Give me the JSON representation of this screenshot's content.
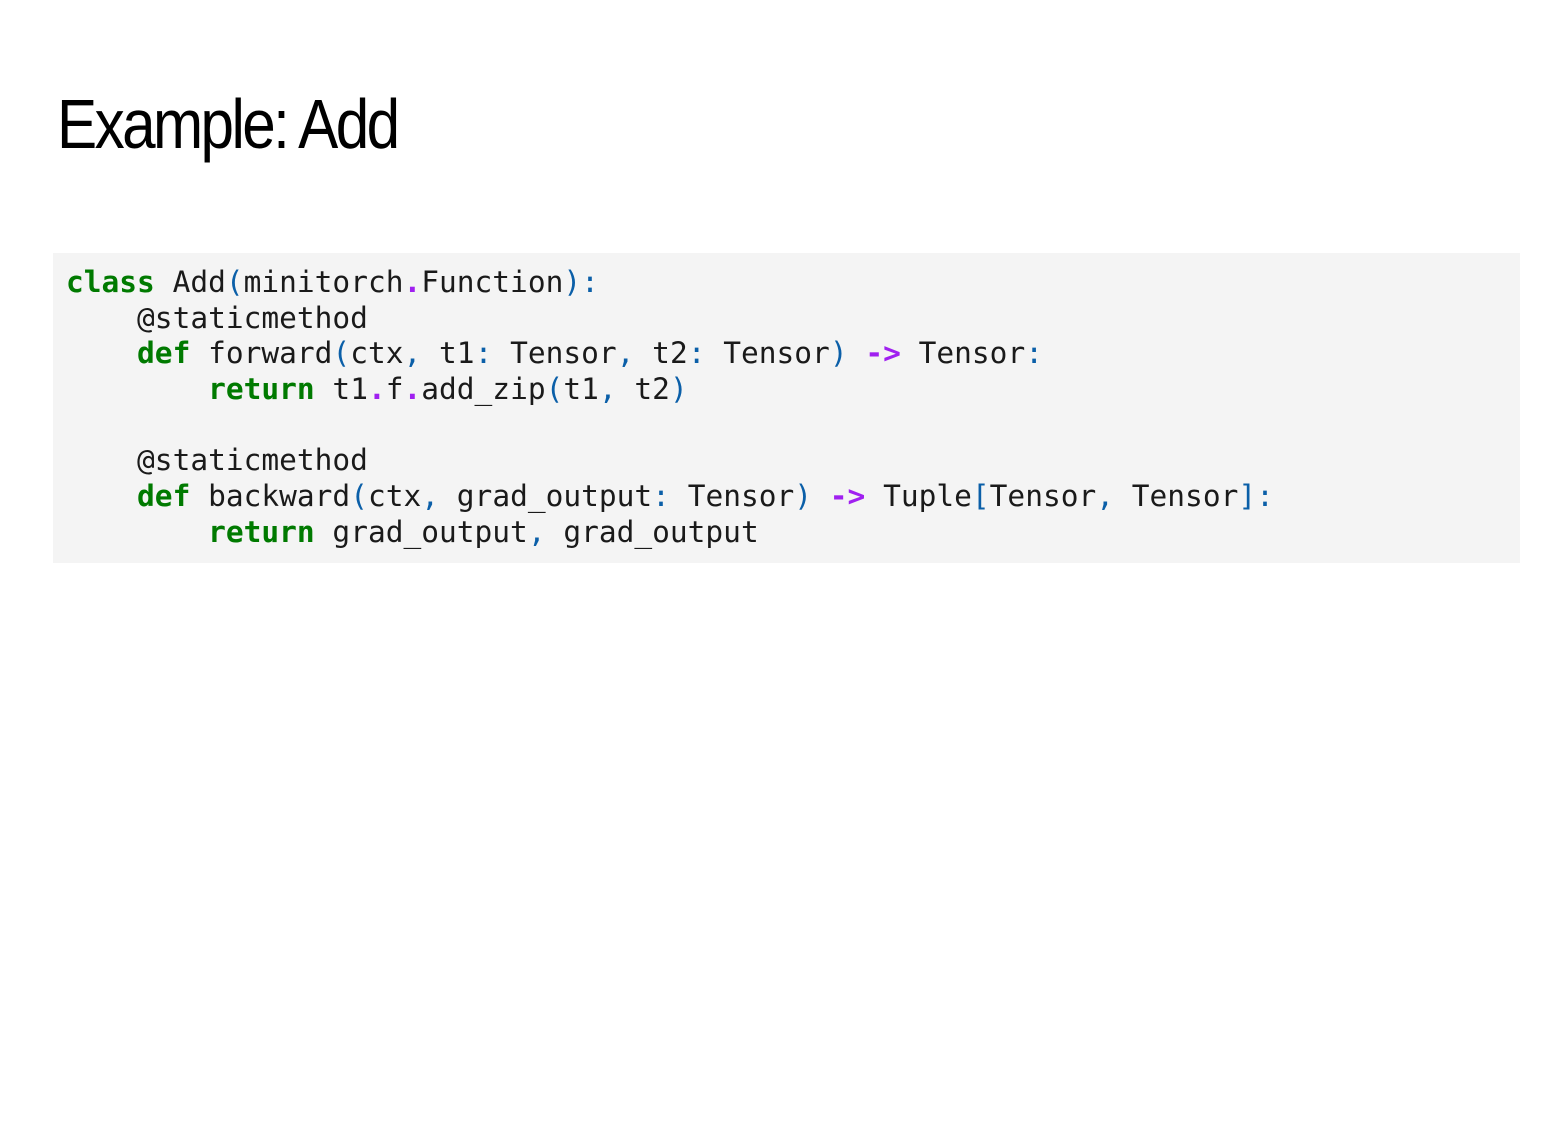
{
  "slide": {
    "title": "Example: Add"
  },
  "code": {
    "language": "python",
    "lines": [
      [
        [
          "kw",
          "class"
        ],
        [
          "t",
          " Add"
        ],
        [
          "p",
          "("
        ],
        [
          "t",
          "minitorch"
        ],
        [
          "op",
          "."
        ],
        [
          "t",
          "Function"
        ],
        [
          "p",
          "):"
        ]
      ],
      [
        [
          "t",
          "    @staticmethod"
        ]
      ],
      [
        [
          "t",
          "    "
        ],
        [
          "kw",
          "def"
        ],
        [
          "t",
          " forward"
        ],
        [
          "p",
          "("
        ],
        [
          "t",
          "ctx"
        ],
        [
          "p",
          ","
        ],
        [
          "t",
          " t1"
        ],
        [
          "p",
          ":"
        ],
        [
          "t",
          " Tensor"
        ],
        [
          "p",
          ","
        ],
        [
          "t",
          " t2"
        ],
        [
          "p",
          ":"
        ],
        [
          "t",
          " Tensor"
        ],
        [
          "p",
          ")"
        ],
        [
          "t",
          " "
        ],
        [
          "op",
          "->"
        ],
        [
          "t",
          " Tensor"
        ],
        [
          "p",
          ":"
        ]
      ],
      [
        [
          "t",
          "        "
        ],
        [
          "kw",
          "return"
        ],
        [
          "t",
          " t1"
        ],
        [
          "op",
          "."
        ],
        [
          "t",
          "f"
        ],
        [
          "op",
          "."
        ],
        [
          "t",
          "add_zip"
        ],
        [
          "p",
          "("
        ],
        [
          "t",
          "t1"
        ],
        [
          "p",
          ","
        ],
        [
          "t",
          " t2"
        ],
        [
          "p",
          ")"
        ]
      ],
      [],
      [
        [
          "t",
          "    @staticmethod"
        ]
      ],
      [
        [
          "t",
          "    "
        ],
        [
          "kw",
          "def"
        ],
        [
          "t",
          " backward"
        ],
        [
          "p",
          "("
        ],
        [
          "t",
          "ctx"
        ],
        [
          "p",
          ","
        ],
        [
          "t",
          " grad_output"
        ],
        [
          "p",
          ":"
        ],
        [
          "t",
          " Tensor"
        ],
        [
          "p",
          ")"
        ],
        [
          "t",
          " "
        ],
        [
          "op",
          "->"
        ],
        [
          "t",
          " Tuple"
        ],
        [
          "p",
          "["
        ],
        [
          "t",
          "Tensor"
        ],
        [
          "p",
          ","
        ],
        [
          "t",
          " Tensor"
        ],
        [
          "p",
          "]:"
        ]
      ],
      [
        [
          "t",
          "        "
        ],
        [
          "kw",
          "return"
        ],
        [
          "t",
          " grad_output"
        ],
        [
          "p",
          ","
        ],
        [
          "t",
          " grad_output"
        ]
      ]
    ]
  },
  "colors": {
    "keyword": "#007a00",
    "punctuation": "#0b5fa8",
    "operator": "#a020f0",
    "text": "#1a1a1a",
    "code_background": "#f4f4f4"
  }
}
